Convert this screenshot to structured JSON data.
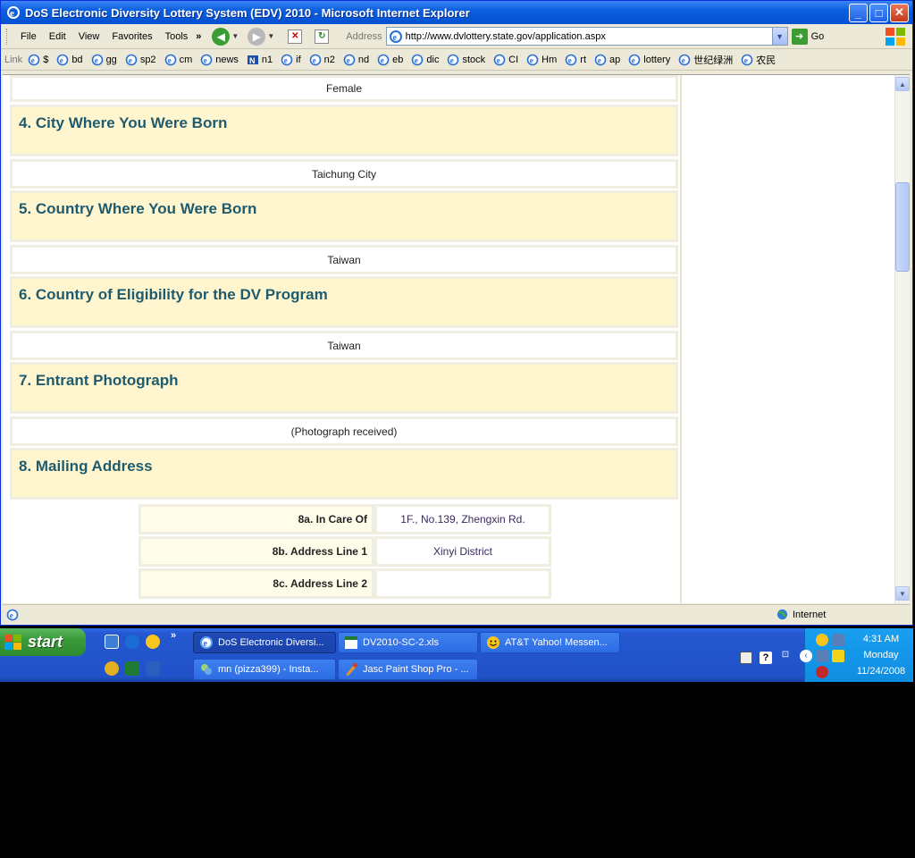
{
  "window": {
    "title": "DoS Electronic Diversity Lottery System (EDV) 2010 - Microsoft Internet Explorer",
    "minimize": "_",
    "maximize": "□",
    "close": "✕"
  },
  "menu": {
    "items": [
      "File",
      "Edit",
      "View",
      "Favorites",
      "Tools"
    ],
    "overflow": "»",
    "address_label": "Address",
    "url": "http://www.dvlottery.state.gov/application.aspx",
    "go_label": "Go"
  },
  "links": {
    "label": "Link",
    "items": [
      "$",
      "bd",
      "gg",
      "sp2",
      "cm",
      "news",
      "n1",
      "if",
      "n2",
      "nd",
      "eb",
      "dic",
      "stock",
      "CI",
      "Hm",
      "rt",
      "ap",
      "lottery",
      "世纪绿洲",
      "农民"
    ]
  },
  "form": {
    "gender_value": "Female",
    "q4_title": "4. City Where You Were Born",
    "q4_value": "Taichung City",
    "q5_title": "5. Country Where You Were Born",
    "q5_value": "Taiwan",
    "q6_title": "6. Country of Eligibility for the DV Program",
    "q6_value": "Taiwan",
    "q7_title": "7. Entrant Photograph",
    "q7_value": "(Photograph received)",
    "q8_title": "8. Mailing Address",
    "q8a_label": "8a. In Care Of",
    "q8a_value": "1F., No.139, Zhengxin Rd.",
    "q8b_label": "8b. Address Line 1",
    "q8b_value": "Xinyi District",
    "q8c_label": "8c. Address Line 2",
    "q8c_value": ""
  },
  "status": {
    "zone": "Internet"
  },
  "taskbar": {
    "start_label": "start",
    "overflow": "»",
    "tasks": [
      "DoS Electronic Diversi...",
      "DV2010-SC-2.xls",
      "AT&T Yahoo! Messen...",
      "mn (pizza399) - Insta...",
      "Jasc Paint Shop Pro - ..."
    ],
    "time": "4:31 AM",
    "day": "Monday",
    "date": "11/24/2008"
  },
  "colors": {
    "question_text": "#1f5b6e",
    "question_bg": "#fff6cf",
    "titlebar": "#0a5fe0"
  }
}
